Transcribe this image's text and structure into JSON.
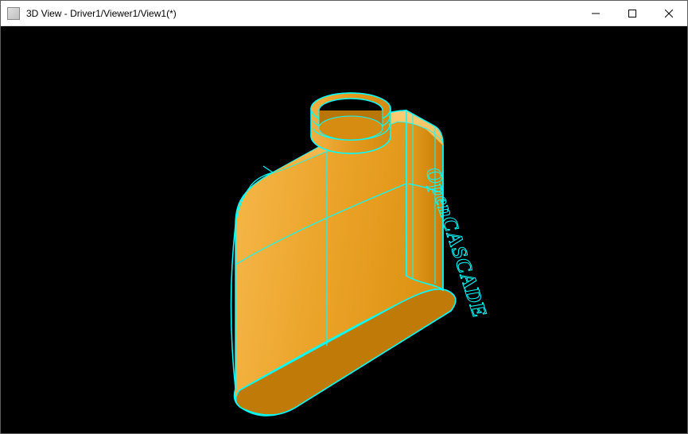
{
  "window": {
    "title": "3D View - Driver1/Viewer1/View1(*)"
  },
  "model": {
    "side_text": "OpenCASCADE"
  },
  "colors": {
    "viewport_bg": "#000000",
    "wire": "#00ffff",
    "face_light": "#f4b13d",
    "face_mid": "#e59d1f",
    "face_dark": "#d68c10",
    "face_top": "#f7bd55"
  },
  "controls": {
    "minimize_label": "Minimize",
    "maximize_label": "Maximize",
    "close_label": "Close"
  }
}
